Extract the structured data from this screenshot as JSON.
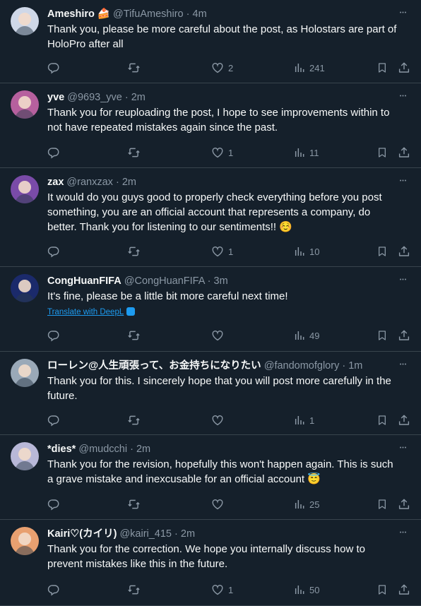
{
  "replies": [
    {
      "name": "Ameshiro",
      "name_emoji": "🍰",
      "handle": "@TifuAmeshiro",
      "time": "4m",
      "lines": [
        "Thank you, please be more careful about the post, as Holostars are part of",
        "HoloPro after all"
      ],
      "likes": "2",
      "views": "241",
      "avatar_color": "#cfd8e8"
    },
    {
      "name": "yve",
      "handle": "@9693_yve",
      "time": "2m",
      "lines": [
        "Thank you for reuploading the post, I hope to see improvements within to",
        "not have repeated mistakes again since the past."
      ],
      "likes": "1",
      "views": "11",
      "avatar_color": "#b6609e"
    },
    {
      "name": "zax",
      "handle": "@ranxzax",
      "time": "2m",
      "lines": [
        "It would do you guys good to properly check everything before you post",
        "something, you are an official account that represents a company, do",
        "better. Thank you for listening to our sentiments!!"
      ],
      "trailing_emoji": "☺️",
      "likes": "1",
      "views": "10",
      "avatar_color": "#7a4ba8"
    },
    {
      "name": "CongHuanFIFA",
      "handle": "@CongHuanFIFA",
      "time": "3m",
      "lines": [
        "It's fine, please be a little bit more careful next time!"
      ],
      "translate": "Translate with DeepL",
      "likes": "",
      "views": "49",
      "avatar_color": "#1b2a6b"
    },
    {
      "name": "ローレン@人生頑張って、お金持ちになりたい",
      "handle": "@fandomofglory",
      "time": "1m",
      "lines": [
        "Thank you for this. I sincerely hope that you will post more carefully in the",
        "future."
      ],
      "likes": "",
      "views": "1",
      "avatar_color": "#9aa9b8"
    },
    {
      "name": "*dies*",
      "handle": "@mudcchi",
      "time": "2m",
      "lines": [
        "Thank you for the revision, hopefully this won't happen again. This is such",
        "a grave mistake and inexcusable for an official account"
      ],
      "trailing_emoji": "😇",
      "likes": "",
      "views": "25",
      "avatar_color": "#b8b8d8"
    },
    {
      "name": "Kairi♡(カイリ)",
      "handle": "@kairi_415",
      "time": "2m",
      "lines": [
        "Thank you for the correction. We hope you internally discuss how to",
        "prevent mistakes like this in the future."
      ],
      "likes": "1",
      "views": "50",
      "avatar_color": "#e8a070"
    }
  ],
  "icons": [
    "reply-icon",
    "retweet-icon",
    "like-icon",
    "views-icon",
    "bookmark-icon",
    "share-icon",
    "more-icon"
  ],
  "colors": {
    "background": "#15202b",
    "muted": "#8b98a5",
    "divider": "#38444d",
    "link": "#1d9bf0"
  }
}
